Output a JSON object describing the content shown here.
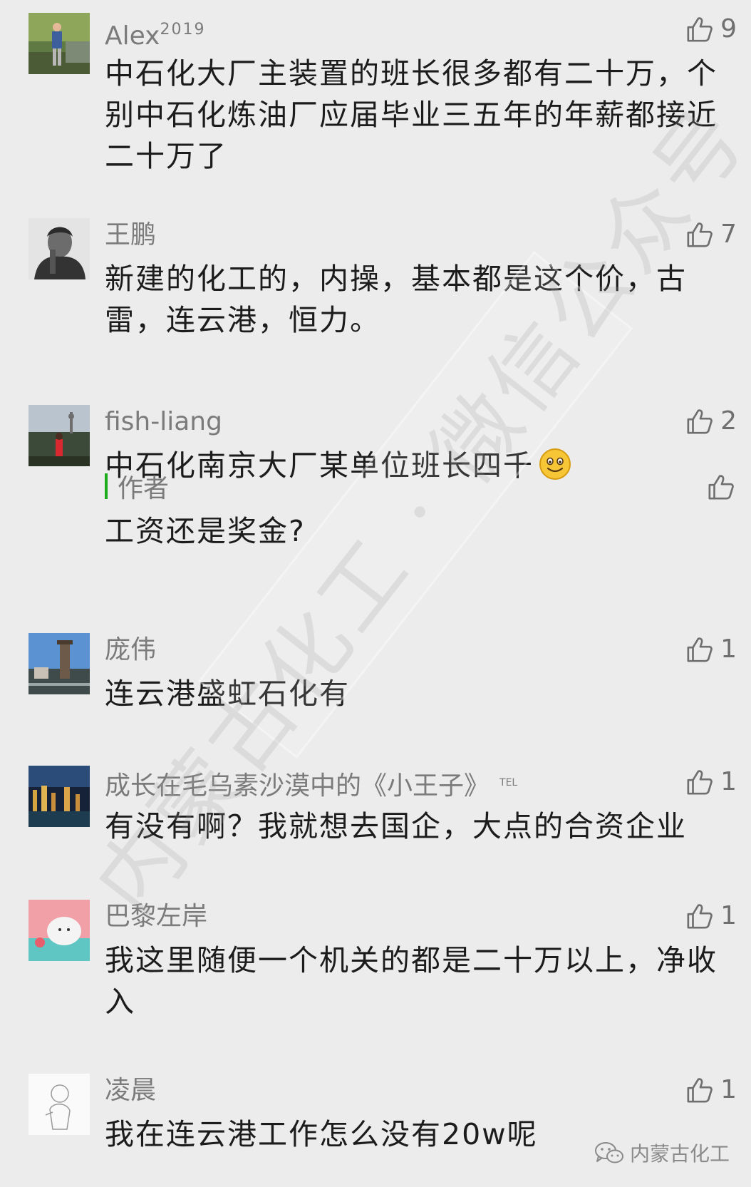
{
  "comments": [
    {
      "name": "Alex",
      "name_sup": "2019",
      "likes": "9",
      "text": "中石化大厂主装置的班长很多都有二十万，个别中石化炼油厂应届毕业三五年的年薪都接近二十万了",
      "avatar_icon": "avatar-person-park"
    },
    {
      "name": "王鹏",
      "likes": "7",
      "text": "新建的化工的，内操，基本都是这个价，古雷，连云港，恒力。",
      "avatar_icon": "avatar-bw-portrait"
    },
    {
      "name": "fish-liang",
      "likes": "2",
      "text": "中石化南京大厂某单位班长四千",
      "emoji": "smile-emoji",
      "avatar_icon": "avatar-city-tower",
      "reply": {
        "author": "作者",
        "text": "工资还是奖金?"
      }
    },
    {
      "name": "庞伟",
      "likes": "1",
      "text": "连云港盛虹石化有",
      "avatar_icon": "avatar-clock-tower"
    },
    {
      "name": "成长在毛乌素沙漠中的《小王子》",
      "name_tag": "TEL",
      "likes": "1",
      "text": "有没有啊？我就想去国企，大点的合资企业",
      "avatar_icon": "avatar-city-night"
    },
    {
      "name": "巴黎左岸",
      "likes": "1",
      "text": "我这里随便一个机关的都是二十万以上，净收入",
      "avatar_icon": "avatar-cartoon-whale"
    },
    {
      "name": "凌晨",
      "likes": "1",
      "text": "我在连云港工作怎么没有20w呢",
      "avatar_icon": "avatar-sketch"
    }
  ],
  "watermark": "内蒙古化工 · 微信公众号",
  "brand": "内蒙古化工",
  "colors": {
    "background": "#ececec",
    "reply_bar": "#1aad19",
    "meta_text": "#7b7b7b"
  }
}
